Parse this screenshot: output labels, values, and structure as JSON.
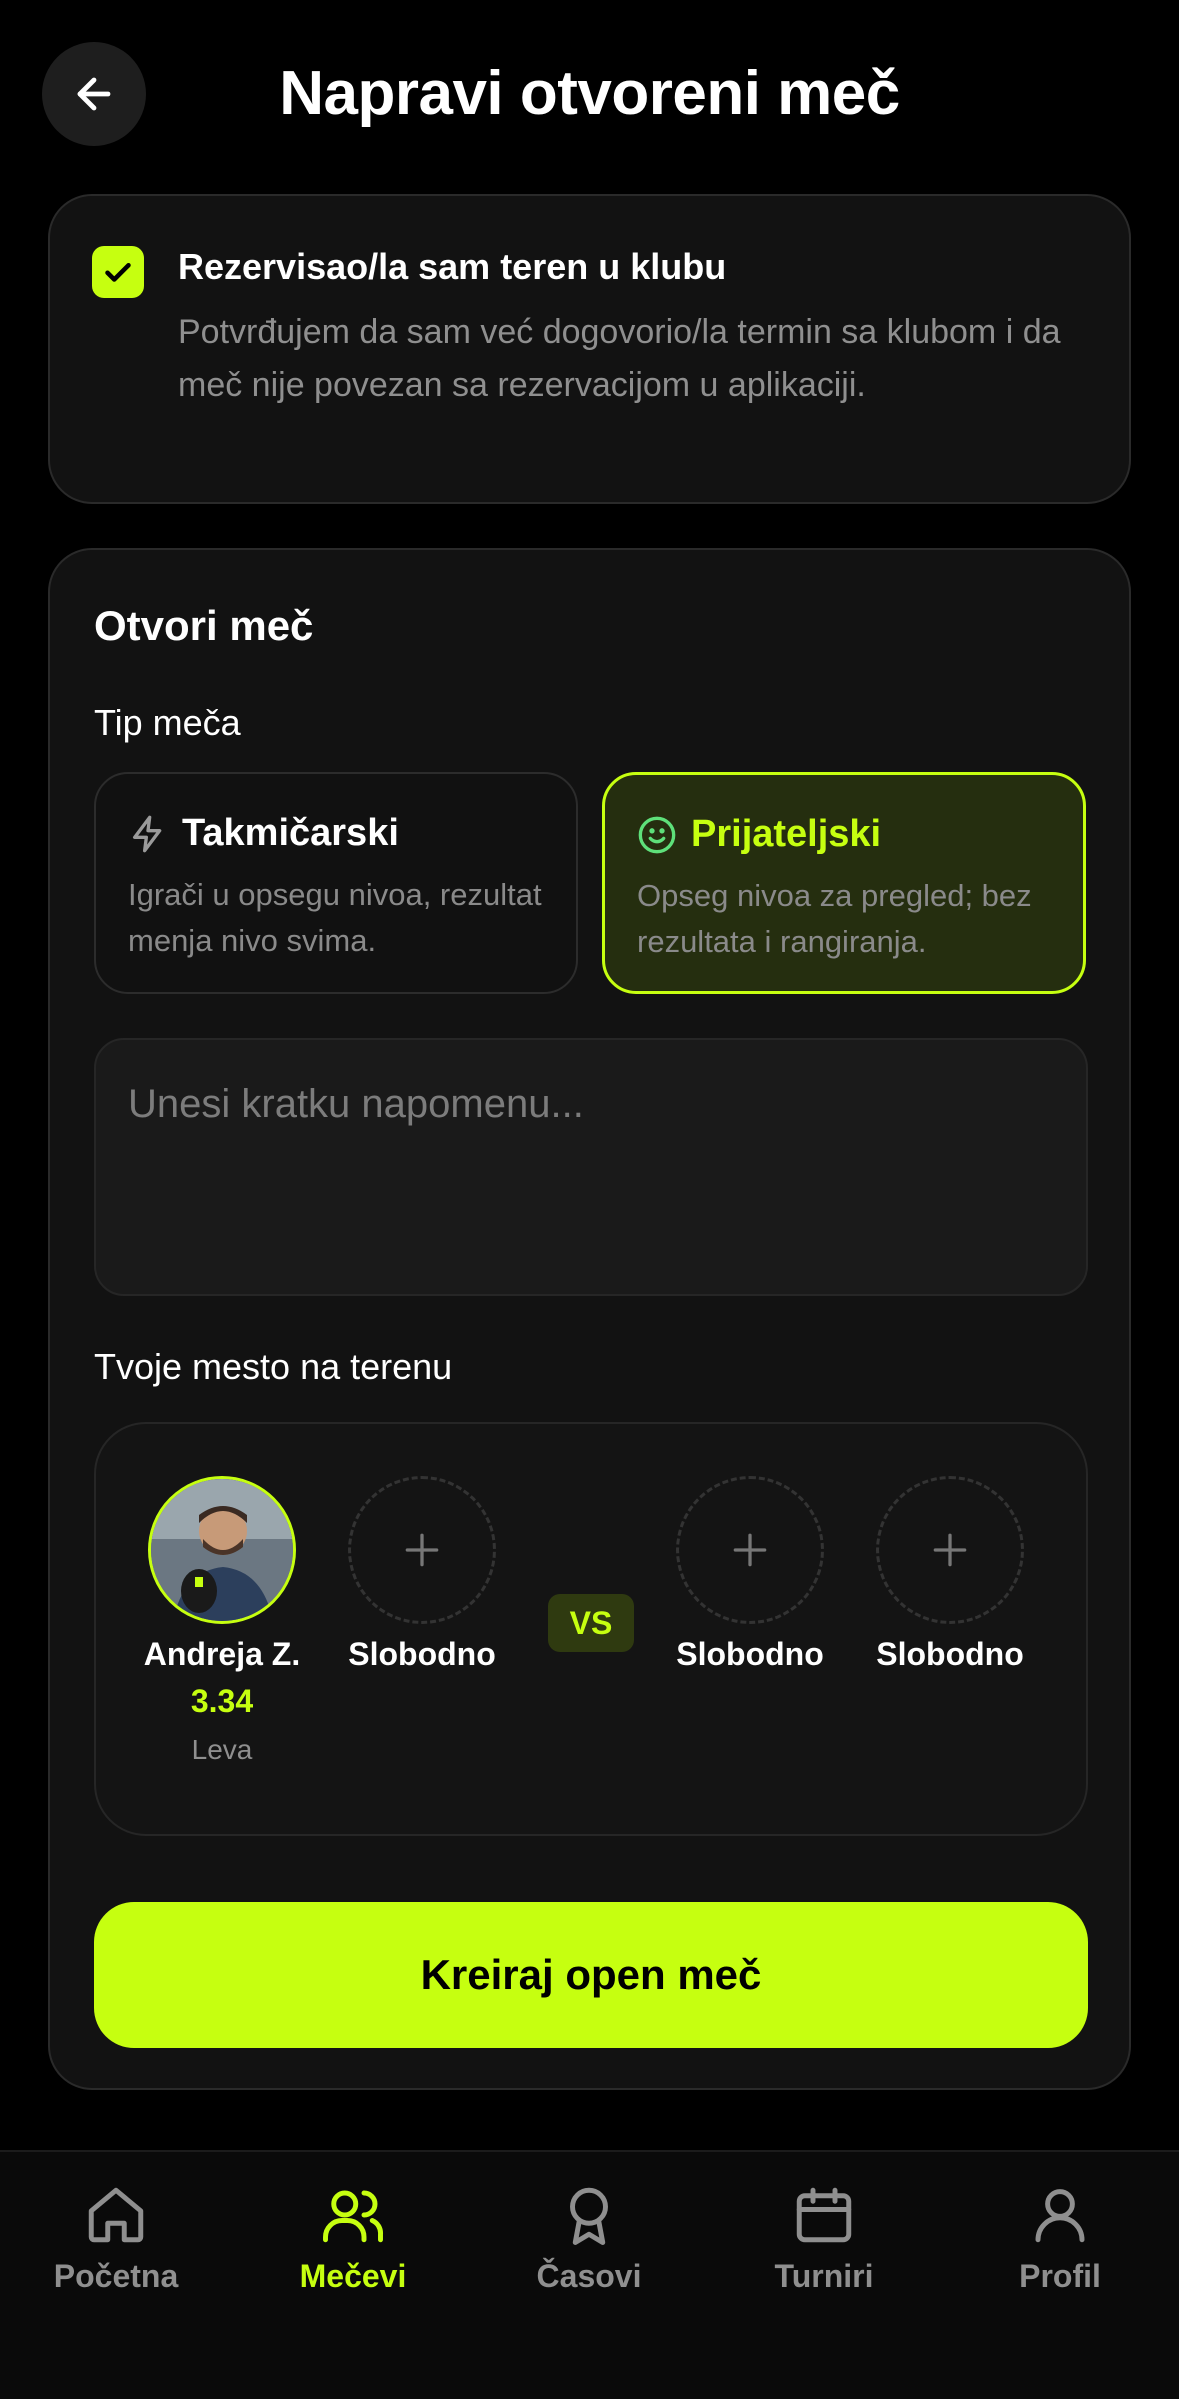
{
  "header": {
    "title": "Napravi otvoreni meč",
    "back_icon": "arrow-left-icon"
  },
  "confirm": {
    "checked": true,
    "title": "Rezervisao/la sam teren u klubu",
    "description": "Potvrđujem da sam već dogovorio/la termin sa klubom i da meč nije povezan sa rezervacijom u aplikaciji."
  },
  "open_match": {
    "title": "Otvori meč",
    "type_label": "Tip meča",
    "types": [
      {
        "name": "Takmičarski",
        "description": "Igrači u opsegu nivoa, rezultat menja nivo svima.",
        "icon": "lightning-icon",
        "selected": false
      },
      {
        "name": "Prijateljski",
        "description": "Opseg nivoa za pregled; bez rezultata i rangiranja.",
        "icon": "smile-icon",
        "selected": true
      }
    ],
    "note_placeholder": "Unesi kratku napomenu...",
    "spot_label": "Tvoje mesto na terenu",
    "players": [
      {
        "name": "Andreja Z.",
        "rating": "3.34",
        "side": "Leva"
      },
      {
        "name": "Slobodno"
      },
      {
        "name": "Slobodno"
      },
      {
        "name": "Slobodno"
      }
    ],
    "vs_label": "VS",
    "create_label": "Kreiraj open meč"
  },
  "tabs": [
    {
      "label": "Početna",
      "icon": "home-icon",
      "active": false
    },
    {
      "label": "Mečevi",
      "icon": "users-icon",
      "active": true
    },
    {
      "label": "Časovi",
      "icon": "award-icon",
      "active": false
    },
    {
      "label": "Turniri",
      "icon": "calendar-icon",
      "active": false
    },
    {
      "label": "Profil",
      "icon": "user-icon",
      "active": false
    }
  ],
  "colors": {
    "accent": "#c6ff10",
    "background": "#000000",
    "card": "#121212",
    "muted_text": "#8f8f8f"
  }
}
